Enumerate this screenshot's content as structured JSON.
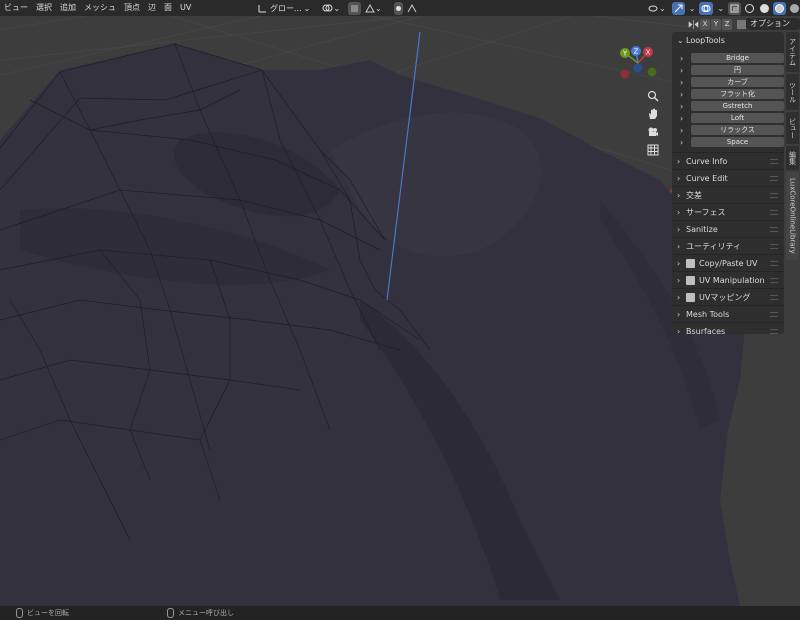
{
  "header": {
    "menus": [
      "ビュー",
      "選択",
      "追加",
      "メッシュ",
      "頂点",
      "辺",
      "面",
      "UV"
    ],
    "transform_orientation": "グロー...",
    "mirror_axes": [
      "X",
      "Y",
      "Z"
    ],
    "options_label": "オプション"
  },
  "gizmo": {
    "x_label": "X",
    "y_label": "Y",
    "z_label": "Z"
  },
  "sidebar": {
    "looptools": {
      "title": "LoopTools",
      "buttons": [
        "Bridge",
        "円",
        "カーブ",
        "フラット化",
        "Gstretch",
        "Loft",
        "リラックス",
        "Space"
      ]
    },
    "panels": [
      {
        "label": "Curve Info",
        "icon": false
      },
      {
        "label": "Curve Edit",
        "icon": false
      },
      {
        "label": "交差",
        "icon": false
      },
      {
        "label": "サーフェス",
        "icon": false
      },
      {
        "label": "Sanitize",
        "icon": false
      },
      {
        "label": "ユーティリティ",
        "icon": false
      },
      {
        "label": "Copy/Paste UV",
        "icon": true
      },
      {
        "label": "UV Manipulation",
        "icon": true
      },
      {
        "label": "UVマッピング",
        "icon": true
      },
      {
        "label": "Mesh Tools",
        "icon": false
      },
      {
        "label": "Bsurfaces",
        "icon": false
      }
    ]
  },
  "tabs": [
    "アイテム",
    "ツール",
    "ビュー",
    "編集",
    "LuxCoreOnlineLibrary"
  ],
  "status": {
    "rotate_view": "ビューを回転",
    "call_menu": "メニュー呼び出し"
  },
  "colors": {
    "viewport_bg": "#3d3d3d",
    "mesh_fill": "#34313f",
    "axis_x": "#ff3352",
    "axis_y": "#8bdc00",
    "axis_z": "#2890ff",
    "accent": "#4772b3"
  }
}
